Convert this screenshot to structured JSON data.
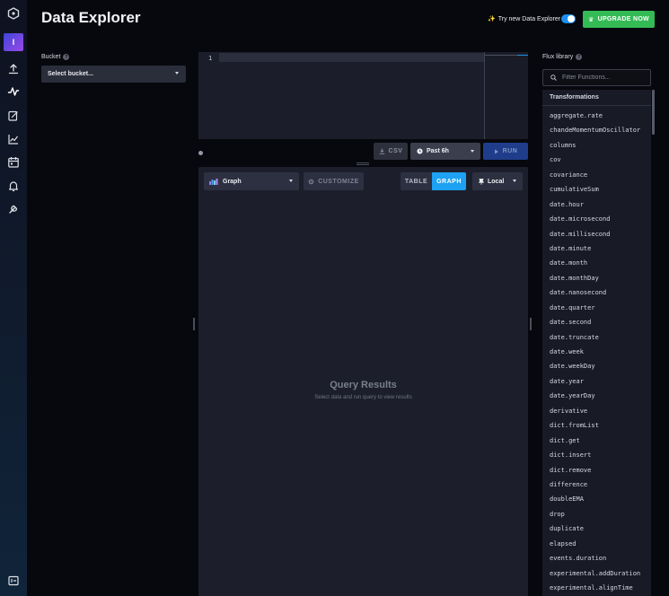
{
  "header": {
    "title": "Data Explorer",
    "try_new": "Try new Data Explorer",
    "upgrade": "UPGRADE NOW"
  },
  "nav": {
    "org_initial": "I",
    "items": [
      "upload-icon",
      "data-explorer-icon",
      "notebook-icon",
      "dashboards-icon",
      "tasks-icon",
      "alerts-icon",
      "settings-icon"
    ],
    "bottom": "collapse-icon"
  },
  "bucket": {
    "label": "Bucket",
    "selected": "Select bucket..."
  },
  "editor": {
    "line_number": "1",
    "csv_label": "CSV",
    "time_range": "Past 6h",
    "run_label": "RUN"
  },
  "results": {
    "vis_type": "Graph",
    "customize": "CUSTOMIZE",
    "view_table": "TABLE",
    "view_graph": "GRAPH",
    "timezone": "Local",
    "empty_title": "Query Results",
    "empty_subtitle": "Select data and run query to view results"
  },
  "flux": {
    "label": "Flux library",
    "filter_placeholder": "Filter Functions...",
    "category": "Transformations",
    "functions": [
      "aggregate.rate",
      "chandeMomentumOscillator",
      "columns",
      "cov",
      "covariance",
      "cumulativeSum",
      "date.hour",
      "date.microsecond",
      "date.millisecond",
      "date.minute",
      "date.month",
      "date.monthDay",
      "date.nanosecond",
      "date.quarter",
      "date.second",
      "date.truncate",
      "date.week",
      "date.weekDay",
      "date.year",
      "date.yearDay",
      "derivative",
      "dict.fromList",
      "dict.get",
      "dict.insert",
      "dict.remove",
      "difference",
      "doubleEMA",
      "drop",
      "duplicate",
      "elapsed",
      "events.duration",
      "experimental.addDuration",
      "experimental.alignTime"
    ]
  },
  "colors": {
    "accent_blue": "#1da1f2",
    "upgrade_green": "#34bb55",
    "run_blue": "#1f3d8a"
  }
}
